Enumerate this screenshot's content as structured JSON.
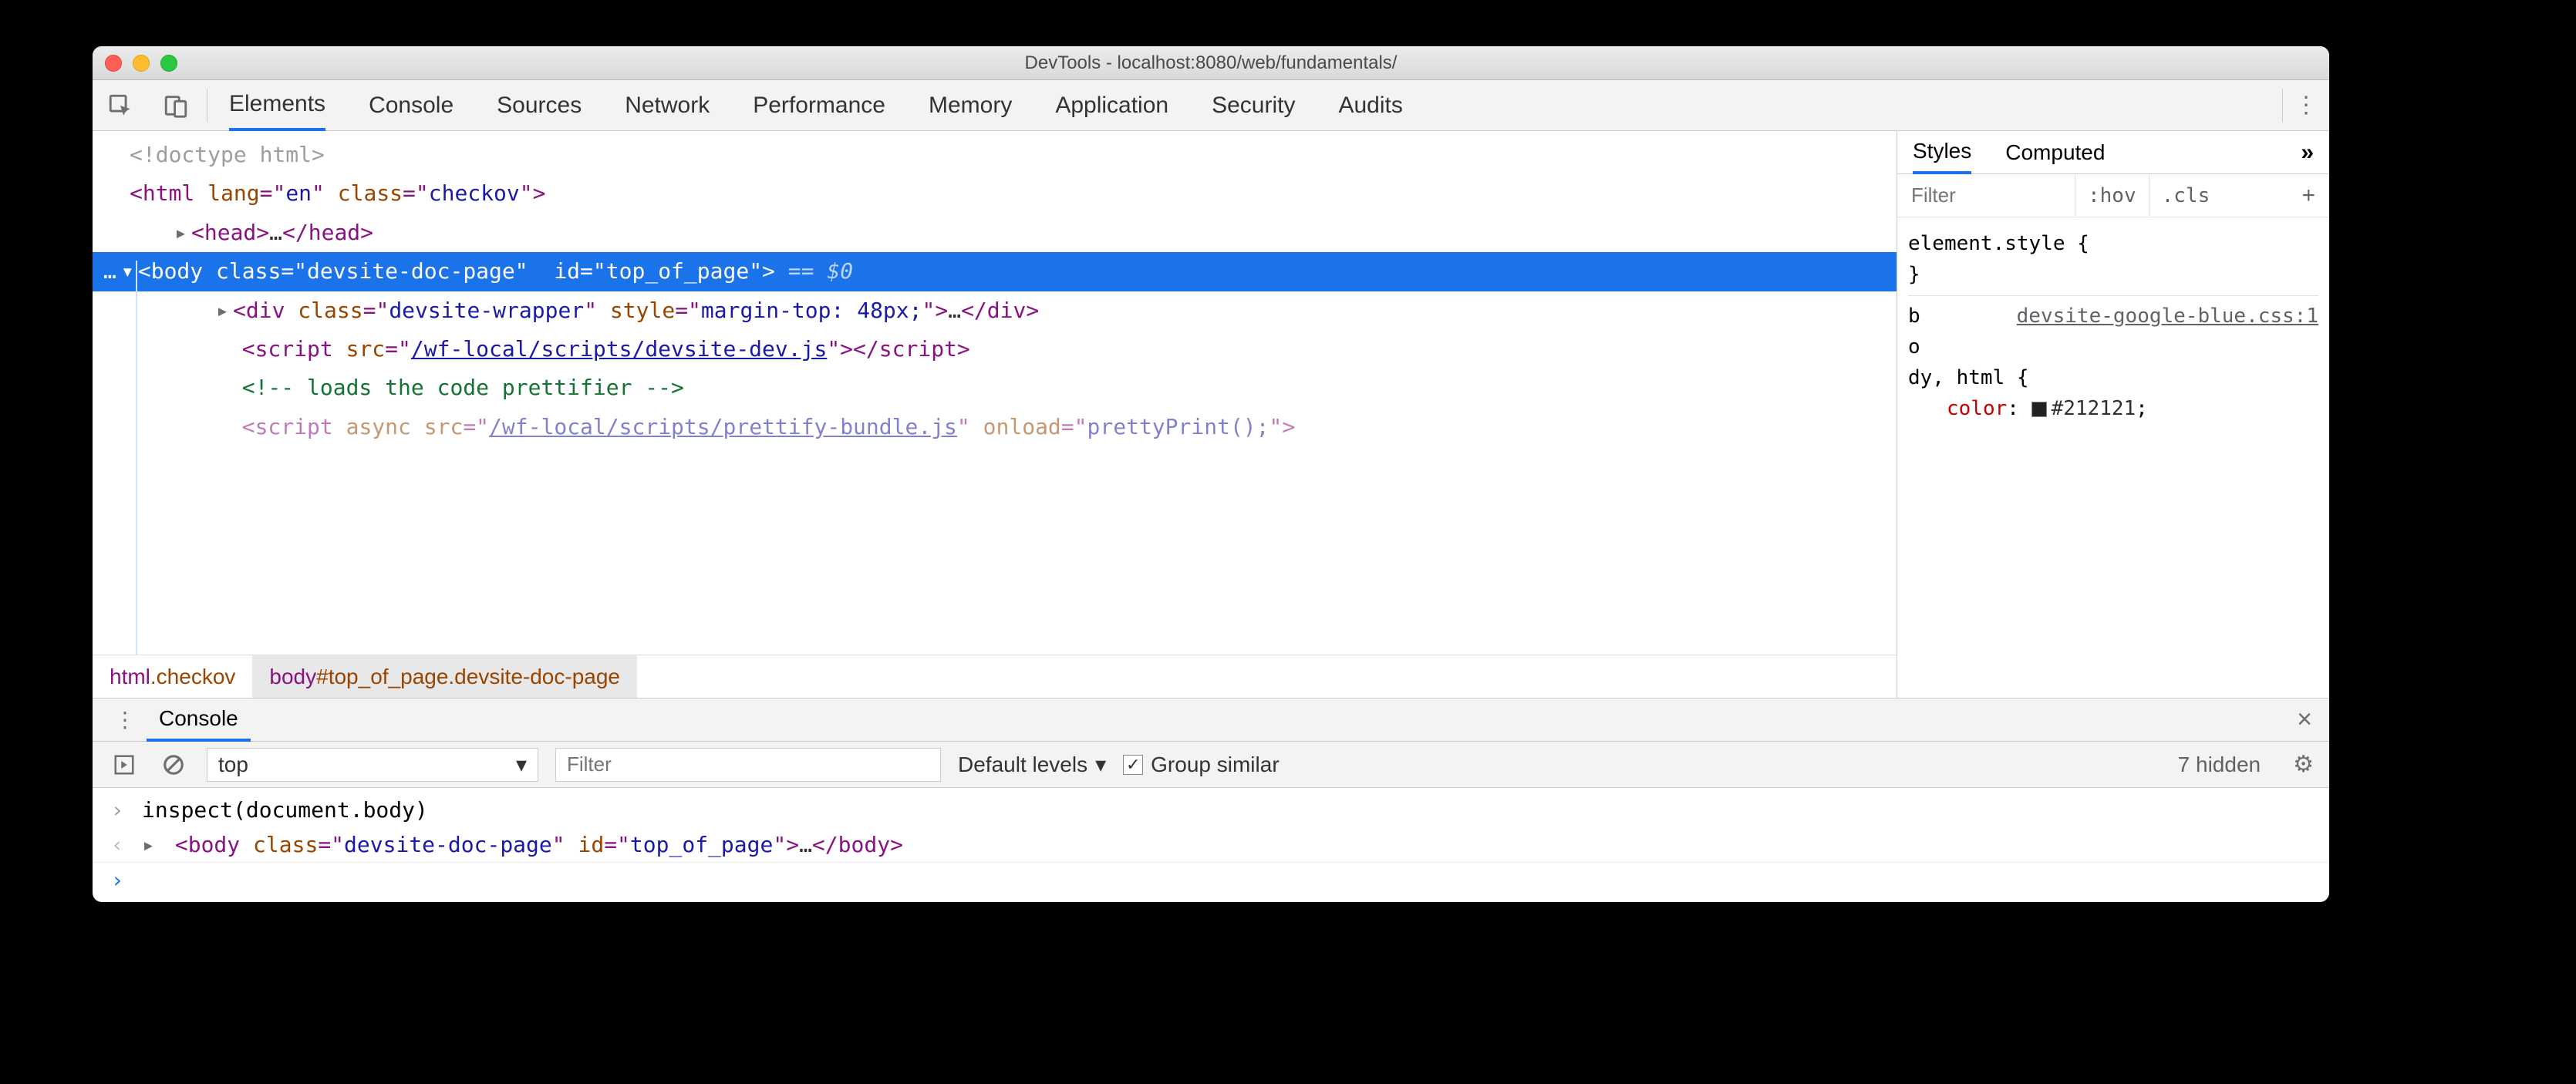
{
  "window": {
    "title": "DevTools - localhost:8080/web/fundamentals/"
  },
  "tabs": {
    "items": [
      "Elements",
      "Console",
      "Sources",
      "Network",
      "Performance",
      "Memory",
      "Application",
      "Security",
      "Audits"
    ],
    "active": "Elements"
  },
  "dom": {
    "line0": "<!doctype html>",
    "line1": {
      "open": "<",
      "tag": "html",
      "attrs": [
        [
          "lang",
          "en"
        ],
        [
          "class",
          "checkov"
        ]
      ],
      "close": ">"
    },
    "line2": {
      "tri": "▸",
      "open": "<",
      "tag": "head",
      "mid": ">…</",
      "tag2": "head",
      "close": ">"
    },
    "selected": {
      "pre": "…",
      "tri": "▾",
      "open": "<",
      "tag": "body",
      "attrs": [
        [
          "class",
          "devsite-doc-page"
        ],
        [
          "id",
          "top_of_page"
        ]
      ],
      "close": ">",
      "ghost": " == $0"
    },
    "line4": {
      "tri": "▸",
      "open": "<",
      "tag": "div",
      "attrs": [
        [
          "class",
          "devsite-wrapper"
        ],
        [
          "style",
          "margin-top: 48px;"
        ]
      ],
      "close": ">",
      "mid": "…</",
      "tag2": "div",
      "close2": ">"
    },
    "line5": {
      "open": "<",
      "tag": "script",
      "srcLabel": "src",
      "srcVal": "/wf-local/scripts/devsite-dev.js",
      "close": ">",
      "endOpen": "</",
      "tag2": "script",
      "endClose": ">"
    },
    "line6_comment": "<!-- loads the code prettifier -->",
    "line7": {
      "open": "<",
      "tag": "script",
      "parts": [
        [
          "async",
          ""
        ],
        [
          "src",
          "/wf-local/scripts/prettify-bundle.js"
        ],
        [
          "onload",
          "prettyPrint();"
        ]
      ],
      "close": ">"
    }
  },
  "breadcrumbs": {
    "a_tag": "html",
    "a_cls": ".checkov",
    "b_tag": "body",
    "b_id": "#top_of_page",
    "b_cls": ".devsite-doc-page"
  },
  "styles": {
    "tabs": [
      "Styles",
      "Computed"
    ],
    "more": "»",
    "filter_placeholder": "Filter",
    "hov": ":hov",
    "cls": ".cls",
    "element_style_label": "element.style {",
    "element_style_close": "}",
    "rule_sel_prefix": "b\no\ndy",
    "rule_src": "devsite-google-blue.css:1",
    "rule_line": "dy, html {",
    "prop_name": "color",
    "prop_value": "#212121",
    "prop_suffix": ";"
  },
  "drawer": {
    "tab": "Console",
    "context": "top",
    "filter_placeholder": "Filter",
    "levels_label": "Default levels",
    "group_label": "Group similar",
    "hidden": "7 hidden"
  },
  "console": {
    "row1": "inspect(document.body)",
    "row2": {
      "open": "<",
      "tag": "body",
      "attrs": [
        [
          "class",
          "devsite-doc-page"
        ],
        [
          "id",
          "top_of_page"
        ]
      ],
      "close": ">",
      "mid": "…</",
      "tag2": "body",
      "close2": ">"
    }
  }
}
